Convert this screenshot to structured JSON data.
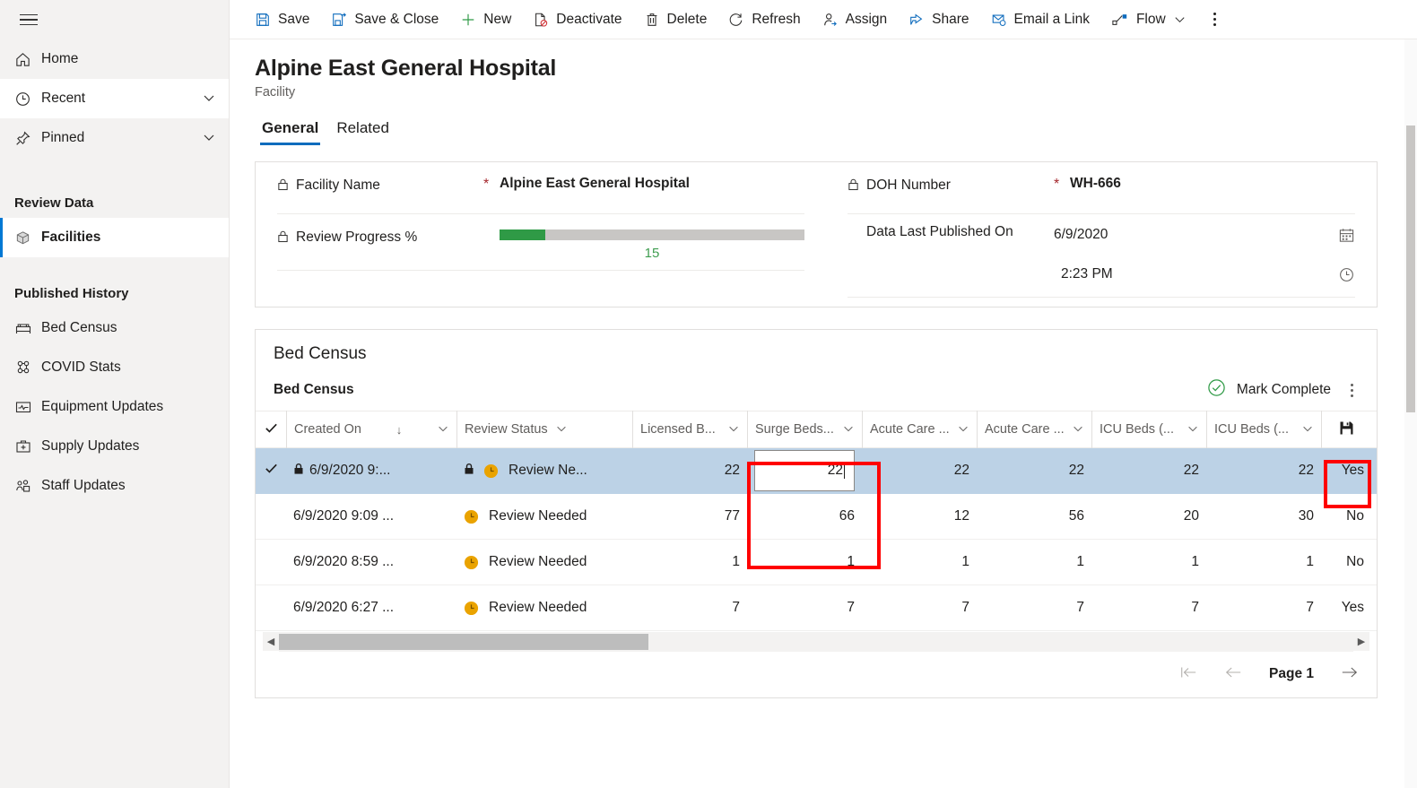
{
  "sidebar": {
    "hamburger": "menu-icon",
    "items": [
      {
        "label": "Home",
        "icon": "home-icon",
        "expandable": false
      },
      {
        "label": "Recent",
        "icon": "clock-icon",
        "expandable": true
      },
      {
        "label": "Pinned",
        "icon": "pin-icon",
        "expandable": true
      }
    ],
    "groups": [
      {
        "title": "Review Data",
        "items": [
          {
            "label": "Facilities",
            "icon": "cube-icon",
            "selected": true
          }
        ]
      },
      {
        "title": "Published History",
        "items": [
          {
            "label": "Bed Census",
            "icon": "bed-icon",
            "selected": false
          },
          {
            "label": "COVID Stats",
            "icon": "covid-icon",
            "selected": false
          },
          {
            "label": "Equipment Updates",
            "icon": "monitor-icon",
            "selected": false
          },
          {
            "label": "Supply Updates",
            "icon": "medkit-icon",
            "selected": false
          },
          {
            "label": "Staff Updates",
            "icon": "people-icon",
            "selected": false
          }
        ]
      }
    ]
  },
  "commandbar": {
    "items": [
      {
        "label": "Save",
        "icon": "save-icon"
      },
      {
        "label": "Save & Close",
        "icon": "save-close-icon"
      },
      {
        "label": "New",
        "icon": "plus-icon"
      },
      {
        "label": "Deactivate",
        "icon": "deactivate-icon"
      },
      {
        "label": "Delete",
        "icon": "trash-icon"
      },
      {
        "label": "Refresh",
        "icon": "refresh-icon"
      },
      {
        "label": "Assign",
        "icon": "assign-person-icon"
      },
      {
        "label": "Share",
        "icon": "share-icon"
      },
      {
        "label": "Email a Link",
        "icon": "email-link-icon"
      },
      {
        "label": "Flow",
        "icon": "flow-icon",
        "caret": true
      }
    ],
    "overflow": "more-commands-icon"
  },
  "record": {
    "title": "Alpine East General Hospital",
    "subtitle": "Facility",
    "tabs": [
      {
        "label": "General",
        "active": true
      },
      {
        "label": "Related",
        "active": false
      }
    ]
  },
  "form": {
    "left": {
      "facility_name": {
        "label": "Facility Name",
        "required": "*",
        "value": "Alpine East General Hospital",
        "locked": true
      },
      "review_progress": {
        "label": "Review Progress %",
        "locked": true,
        "value": "15",
        "percent": 15
      }
    },
    "right": {
      "doh_number": {
        "label": "DOH Number",
        "required": "*",
        "value": "WH-666",
        "locked": true
      },
      "data_last_published": {
        "label": "Data Last Published On",
        "date": "6/9/2020",
        "time": "2:23 PM",
        "date_icon": "calendar-icon",
        "time_icon": "clock-icon"
      }
    }
  },
  "bed_census": {
    "section_title": "Bed Census",
    "subgrid_title": "Bed Census",
    "mark_complete": "Mark Complete",
    "mark_complete_icon": "check-circle-icon",
    "more_icon": "more-vertical-icon",
    "save_row_icon": "save-icon",
    "columns": [
      {
        "key": "check",
        "label": "",
        "icon": "checkmark-icon"
      },
      {
        "key": "created",
        "label": "Created On",
        "sort": "↓",
        "caret": true
      },
      {
        "key": "status",
        "label": "Review Status",
        "caret": true
      },
      {
        "key": "licensed",
        "label": "Licensed B...",
        "caret": true
      },
      {
        "key": "surge",
        "label": "Surge Beds...",
        "caret": true
      },
      {
        "key": "acute1",
        "label": "Acute Care ...",
        "caret": true
      },
      {
        "key": "acute2",
        "label": "Acute Care ...",
        "caret": true
      },
      {
        "key": "icu1",
        "label": "ICU Beds (...",
        "caret": true
      },
      {
        "key": "icu2",
        "label": "ICU Beds (...",
        "caret": true
      }
    ],
    "rows": [
      {
        "selected": true,
        "checked": true,
        "locked": true,
        "created": "6/9/2020 9:...",
        "status": "Review Ne...",
        "status_icon": "clock-badge-icon",
        "status_locked": true,
        "licensed": "22",
        "surge": "22",
        "acute1": "22",
        "acute2": "22",
        "icu1": "22",
        "icu2": "22",
        "flag": "Yes",
        "editing": {
          "column": "surge",
          "value": "22"
        }
      },
      {
        "selected": false,
        "checked": false,
        "locked": false,
        "created": "6/9/2020 9:09 ...",
        "status": "Review Needed",
        "status_icon": "clock-badge-icon",
        "licensed": "77",
        "surge": "66",
        "acute1": "12",
        "acute2": "56",
        "icu1": "20",
        "icu2": "30",
        "flag": "No"
      },
      {
        "selected": false,
        "checked": false,
        "locked": false,
        "created": "6/9/2020 8:59 ...",
        "status": "Review Needed",
        "status_icon": "clock-badge-icon",
        "licensed": "1",
        "surge": "1",
        "acute1": "1",
        "acute2": "1",
        "icu1": "1",
        "icu2": "1",
        "flag": "No"
      },
      {
        "selected": false,
        "checked": false,
        "locked": false,
        "created": "6/9/2020 6:27 ...",
        "status": "Review Needed",
        "status_icon": "clock-badge-icon",
        "licensed": "7",
        "surge": "7",
        "acute1": "7",
        "acute2": "7",
        "icu1": "7",
        "icu2": "7",
        "flag": "Yes"
      }
    ],
    "pager": {
      "first_icon": "page-first-icon",
      "prev_icon": "page-prev-icon",
      "label": "Page 1",
      "next_icon": "page-next-icon"
    }
  },
  "colors": {
    "accent": "#0f6cbd",
    "required": "#a4262c",
    "progress_fill": "#2f9a46",
    "progress_text": "#3f9d50",
    "row_selected": "#bcd2e6",
    "annotation": "#ff0000",
    "status_badge": "#eaa300",
    "complete_green": "#2f9a46"
  }
}
